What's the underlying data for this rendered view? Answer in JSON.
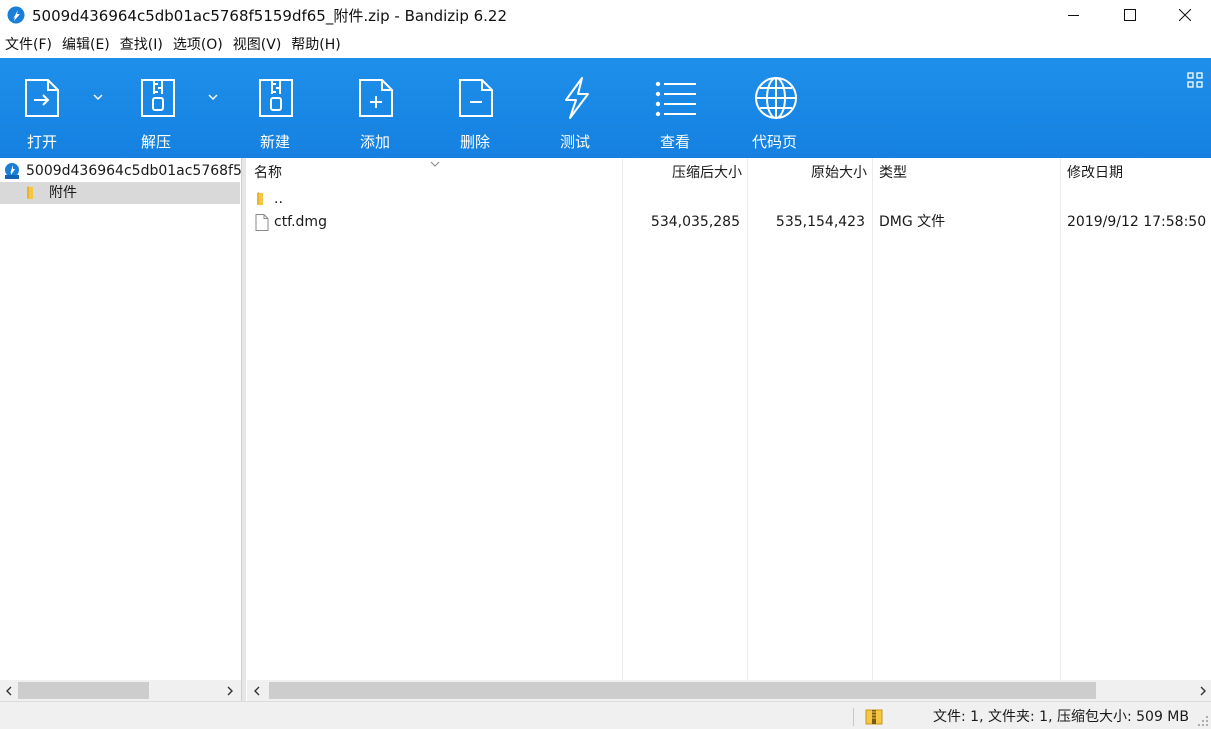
{
  "window": {
    "title": "5009d436964c5db01ac5768f5159df65_附件.zip - Bandizip 6.22"
  },
  "menu": [
    {
      "label": "文件(F)"
    },
    {
      "label": "编辑(E)"
    },
    {
      "label": "查找(I)"
    },
    {
      "label": "选项(O)"
    },
    {
      "label": "视图(V)"
    },
    {
      "label": "帮助(H)"
    }
  ],
  "toolbar": {
    "open": "打开",
    "extract": "解压",
    "new": "新建",
    "add": "添加",
    "delete": "删除",
    "test": "测试",
    "view": "查看",
    "codepage": "代码页"
  },
  "tree": {
    "root": "5009d436964c5db01ac5768f5159df65_附件.zip",
    "child": "附件"
  },
  "columns": {
    "name": "名称",
    "packed": "压缩后大小",
    "original": "原始大小",
    "type": "类型",
    "modified": "修改日期"
  },
  "files": [
    {
      "name": "..",
      "packed": "",
      "original": "",
      "type": "",
      "modified": "",
      "icon": "folder-icon"
    },
    {
      "name": "ctf.dmg",
      "packed": "534,035,285",
      "original": "535,154,423",
      "type": "DMG 文件",
      "modified": "2019/9/12 17:58:50",
      "icon": "file-icon"
    }
  ],
  "status": {
    "text": "文件: 1, 文件夹: 1, 压缩包大小: 509 MB"
  },
  "colors": {
    "toolbar": "#1b8be6",
    "selection": "#d9d9d9"
  }
}
